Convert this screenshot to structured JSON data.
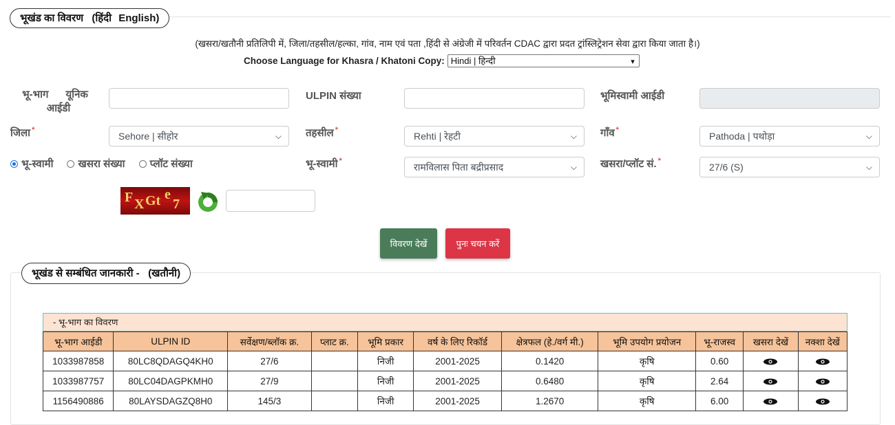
{
  "section1": {
    "legend_title": "भूखंड का विवरण",
    "lang_hindi": "हिंदी",
    "lang_english": "English",
    "note": "(खसरा/खतौनी प्रतिलिपी में, जिला/तहसील/हल्का, गांव, नाम एवं पता ,हिंदी से अंग्रेजी में परिवर्तन CDAC द्वारा प्रदत ट्रांस्लिट्रेशन सेवा द्वारा किया जाता है।)",
    "choose_lang_label": "Choose Language for Khasra / Khatoni Copy:",
    "choose_lang_value": "Hindi | हिन्दी"
  },
  "form": {
    "unique_id_label_1": "भू-भाग      यूनिक",
    "unique_id_label_2": "आईडी",
    "ulpin_label": "ULPIN संख्या",
    "owner_id_label": "भूमिस्वामी आईडी",
    "district_label": "जिला",
    "district_value": "Sehore | सीहोर",
    "tehsil_label": "तहसील",
    "tehsil_value": "Rehti | रेहटी",
    "village_label": "गाँव",
    "village_value": "Pathoda | पथोड़ा",
    "radio_owner": "भू-स्वामी",
    "radio_khasra": "खसरा संख्या",
    "radio_plot": "प्लॉट संख्या",
    "owner_label": "भू-स्वामी",
    "owner_value": "रामविलास पिता बद्रीप्रसाद",
    "khasra_label": "खसरा/प्लॉट सं.",
    "khasra_value": "27/6 (S)",
    "required_mark": "*",
    "captcha_chars": [
      "F",
      "X",
      "Gt",
      "e",
      "7"
    ],
    "view_button": "विवरण देखें",
    "reset_button": "पुनः चयन करें"
  },
  "section2": {
    "legend_title": "भूखंड से सम्बंधित जानकारी -   (खतौनी)",
    "caption": "- भू-भाग का विवरण",
    "columns": [
      "भू-भाग आईडी",
      "ULPIN ID",
      "सर्वेक्षण/ब्लॉक क्र.",
      "प्लाट क्र.",
      "भूमि प्रकार",
      "वर्ष के लिए रिकॉर्ड",
      "क्षेत्रफल (हे./वर्ग मी.)",
      "भूमि उपयोग प्रयोजन",
      "भू-राजस्व",
      "खसरा देखें",
      "नक्शा देखें"
    ],
    "rows": [
      [
        "1033987858",
        "80LC8QDAGQ4KH0",
        "27/6",
        "",
        "निजी",
        "2001-2025",
        "0.1420",
        "कृषि",
        "0.60"
      ],
      [
        "1033987757",
        "80LC04DAGPKMH0",
        "27/9",
        "",
        "निजी",
        "2001-2025",
        "0.6480",
        "कृषि",
        "2.64"
      ],
      [
        "1156490886",
        "80LAYSDAGZQ8H0",
        "145/3",
        "",
        "निजी",
        "2001-2025",
        "1.2670",
        "कृषि",
        "6.00"
      ]
    ]
  },
  "colors": {
    "green_button": "#4a7c59",
    "red_button": "#dc3545",
    "table_header": "#f6c39a",
    "caption_bg": "#fde3d1",
    "required": "#d9534f"
  }
}
